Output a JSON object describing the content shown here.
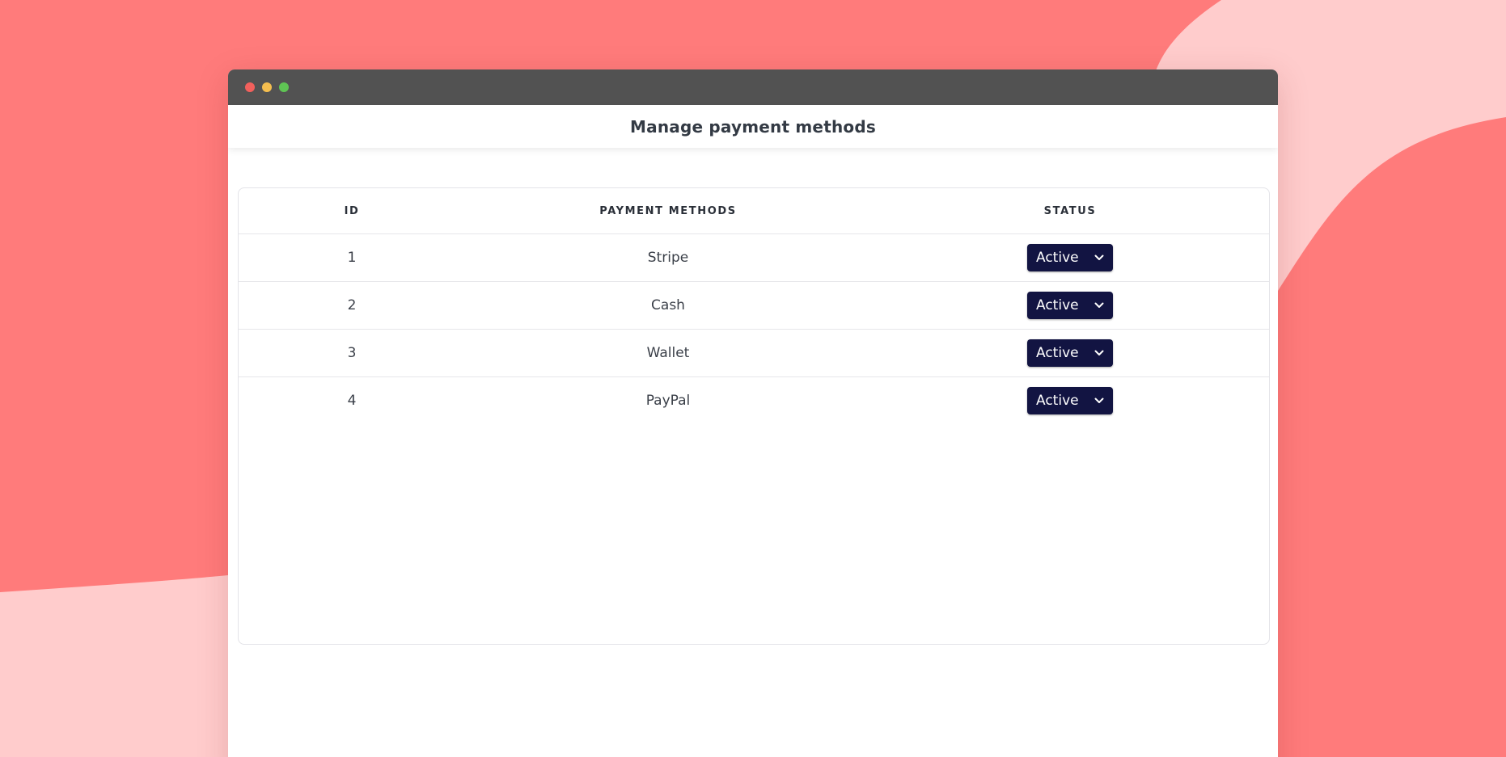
{
  "page": {
    "title": "Manage payment methods"
  },
  "colors": {
    "background": "#ff7b7b",
    "background_light": "#ffcccc",
    "titlebar": "#525252",
    "select_bg": "#121442"
  },
  "window_controls": [
    "close-dot",
    "minimize-dot",
    "maximize-dot"
  ],
  "table": {
    "headers": {
      "id": "ID",
      "method": "PAYMENT METHODS",
      "status": "STATUS"
    },
    "rows": [
      {
        "id": "1",
        "method": "Stripe",
        "status": "Active"
      },
      {
        "id": "2",
        "method": "Cash",
        "status": "Active"
      },
      {
        "id": "3",
        "method": "Wallet",
        "status": "Active"
      },
      {
        "id": "4",
        "method": "PayPal",
        "status": "Active"
      }
    ]
  },
  "icons": {
    "select_chevron": "chevron-down-icon"
  }
}
